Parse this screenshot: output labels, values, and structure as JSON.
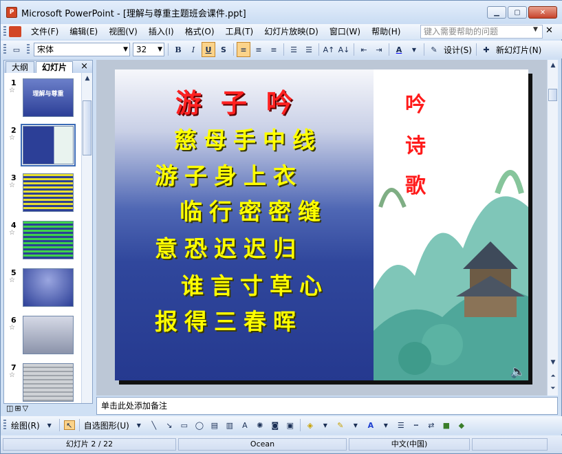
{
  "window": {
    "title": "Microsoft PowerPoint - [理解与尊重主题班会课件.ppt]",
    "app_icon": "P"
  },
  "menu": {
    "items": [
      "文件(F)",
      "编辑(E)",
      "视图(V)",
      "插入(I)",
      "格式(O)",
      "工具(T)",
      "幻灯片放映(D)",
      "窗口(W)",
      "帮助(H)"
    ],
    "help_placeholder": "键入需要帮助的问题"
  },
  "toolbar": {
    "font_name": "宋体",
    "font_size": "32",
    "bold": "B",
    "italic": "I",
    "underline": "U",
    "shadow": "S",
    "font_color": "A",
    "design_label": "设计(S)",
    "new_slide_label": "新幻灯片(N)"
  },
  "pane_tabs": {
    "outline": "大纲",
    "slides": "幻灯片",
    "close": "×"
  },
  "thumbnails": [
    {
      "num": "1",
      "star": "☆",
      "title": "理解与尊重"
    },
    {
      "num": "2",
      "star": "☆",
      "title": ""
    },
    {
      "num": "3",
      "star": "☆",
      "title": ""
    },
    {
      "num": "4",
      "star": "☆",
      "title": ""
    },
    {
      "num": "5",
      "star": "☆",
      "title": ""
    },
    {
      "num": "6",
      "star": "☆",
      "title": ""
    },
    {
      "num": "7",
      "star": "☆",
      "title": ""
    }
  ],
  "slide": {
    "title": "游子吟",
    "lines": [
      "慈母手中线",
      "游子身上衣",
      "临行密密缝",
      "意恐迟迟归",
      "谁言寸草心",
      "报得三春晖"
    ],
    "side_text": [
      "吟",
      "诗",
      "歌"
    ]
  },
  "notes_placeholder": "单击此处添加备注",
  "drawbar": {
    "draw_label": "绘图(R)",
    "autoshape_label": "自选图形(U)"
  },
  "status": {
    "slide_counter": "幻灯片 2 / 22",
    "theme": "Ocean",
    "language": "中文(中国)"
  },
  "colors": {
    "accent": "#3a6ab5",
    "title_red": "#ff2121",
    "poem_yellow": "#ffff00"
  }
}
